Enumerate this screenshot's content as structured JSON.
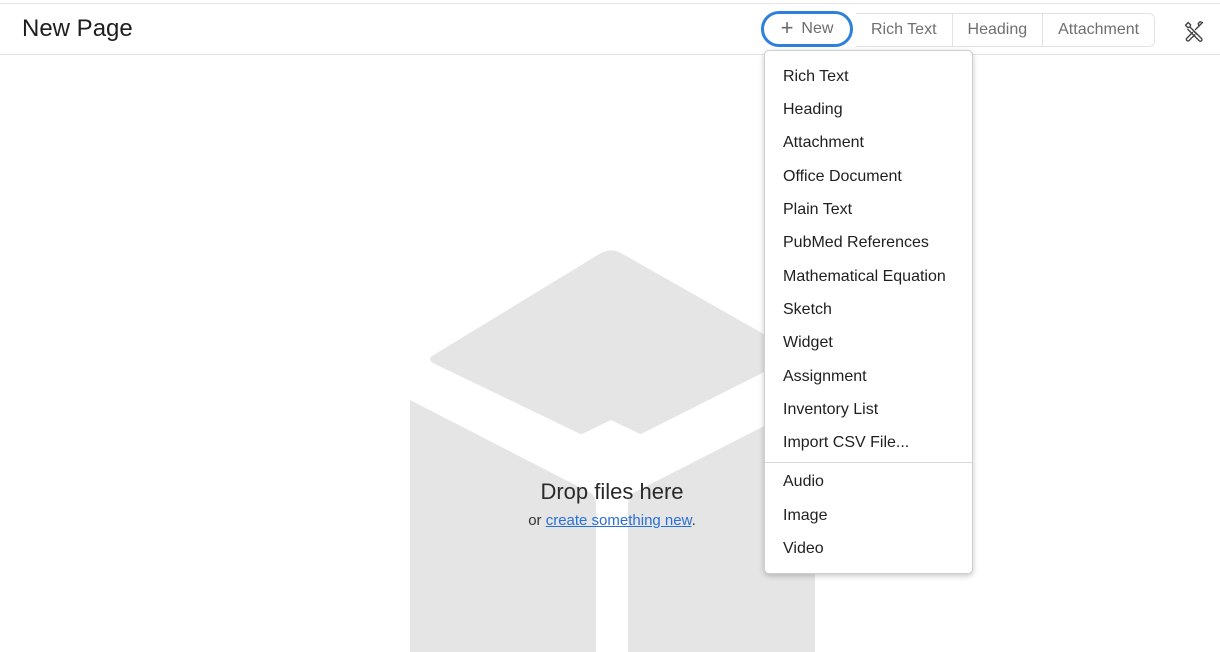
{
  "header": {
    "title": "New Page"
  },
  "toolbar": {
    "new_label": "New",
    "new_icon": "plus-icon",
    "segments": [
      "Rich Text",
      "Heading",
      "Attachment"
    ],
    "tools_icon": "tools-icon",
    "accent_color": "#2f80dc"
  },
  "menu": {
    "group1": [
      "Rich Text",
      "Heading",
      "Attachment",
      "Office Document",
      "Plain Text",
      "PubMed References",
      "Mathematical Equation",
      "Sketch",
      "Widget",
      "Assignment",
      "Inventory List",
      "Import CSV File..."
    ],
    "group2": [
      "Audio",
      "Image",
      "Video"
    ]
  },
  "dropzone": {
    "title": "Drop files here",
    "sub_prefix": "or ",
    "sub_link": "create something new",
    "sub_suffix": ".",
    "illustration_icon": "box-icon",
    "link_color": "#2a6fd6"
  }
}
